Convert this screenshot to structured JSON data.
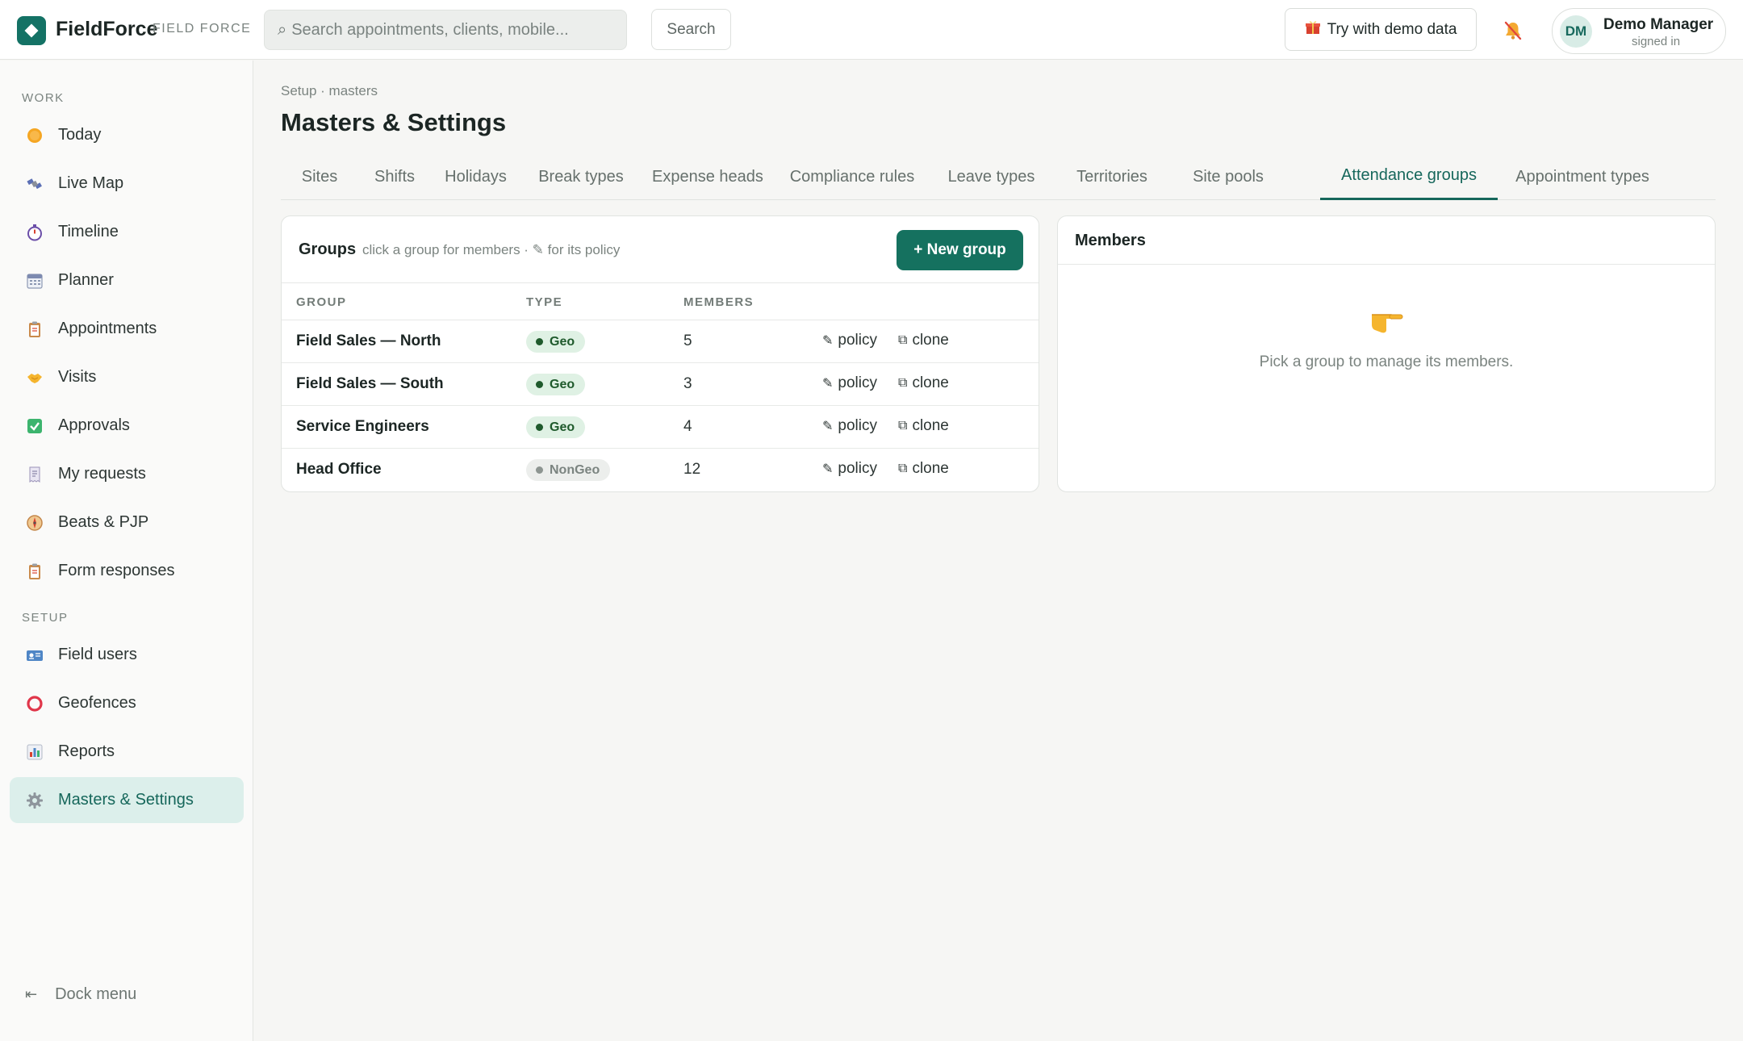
{
  "app": {
    "name": "FieldForce",
    "subtitle": "FIELD FORCE"
  },
  "header": {
    "search_placeholder": "Search appointments, clients, mobile...",
    "search_button": "Search",
    "demo_button": "Try with demo data",
    "user": {
      "initials": "DM",
      "name": "Demo Manager",
      "status": "signed in"
    }
  },
  "sidebar": {
    "work_section": "WORK",
    "setup_section": "SETUP",
    "work_items": [
      {
        "label": "Today",
        "icon": "sun-icon"
      },
      {
        "label": "Live Map",
        "icon": "satellite-icon"
      },
      {
        "label": "Timeline",
        "icon": "stopwatch-icon"
      },
      {
        "label": "Planner",
        "icon": "calendar-icon"
      },
      {
        "label": "Appointments",
        "icon": "clipboard-icon"
      },
      {
        "label": "Visits",
        "icon": "handshake-icon"
      },
      {
        "label": "Approvals",
        "icon": "check-box-icon"
      },
      {
        "label": "My requests",
        "icon": "receipt-icon"
      },
      {
        "label": "Beats & PJP",
        "icon": "compass-icon"
      },
      {
        "label": "Form responses",
        "icon": "clipboard-icon"
      }
    ],
    "setup_items": [
      {
        "label": "Field users",
        "icon": "id-card-icon"
      },
      {
        "label": "Geofences",
        "icon": "ring-icon"
      },
      {
        "label": "Reports",
        "icon": "bar-chart-icon"
      },
      {
        "label": "Masters & Settings",
        "icon": "gear-icon",
        "active": true
      }
    ],
    "dock_label": "Dock menu"
  },
  "page": {
    "breadcrumb": "Setup · masters",
    "title": "Masters & Settings",
    "tabs": [
      "Sites",
      "Shifts",
      "Holidays",
      "Break types",
      "Expense heads",
      "Compliance rules",
      "Leave types",
      "Territories",
      "Site pools",
      "Attendance groups",
      "Appointment types"
    ],
    "active_tab": "Attendance groups"
  },
  "groups": {
    "title": "Groups",
    "hint": "click a group for members · ✎ for its policy",
    "new_button": "+ New group",
    "columns": [
      "GROUP",
      "TYPE",
      "MEMBERS"
    ],
    "policy_label": "policy",
    "clone_label": "clone",
    "rows": [
      {
        "name": "Field Sales — North",
        "type": "Geo",
        "members": "5"
      },
      {
        "name": "Field Sales — South",
        "type": "Geo",
        "members": "3"
      },
      {
        "name": "Service Engineers",
        "type": "Geo",
        "members": "4"
      },
      {
        "name": "Head Office",
        "type": "NonGeo",
        "members": "12"
      }
    ]
  },
  "members": {
    "title": "Members",
    "empty_text": "Pick a group to manage its members."
  },
  "colors": {
    "accent": "#16675b",
    "primary_button": "#15715f",
    "geo_badge_bg": "#dff1e4",
    "geo_badge_text": "#1f5a2c",
    "nongeo_badge_bg": "#eceeec"
  }
}
